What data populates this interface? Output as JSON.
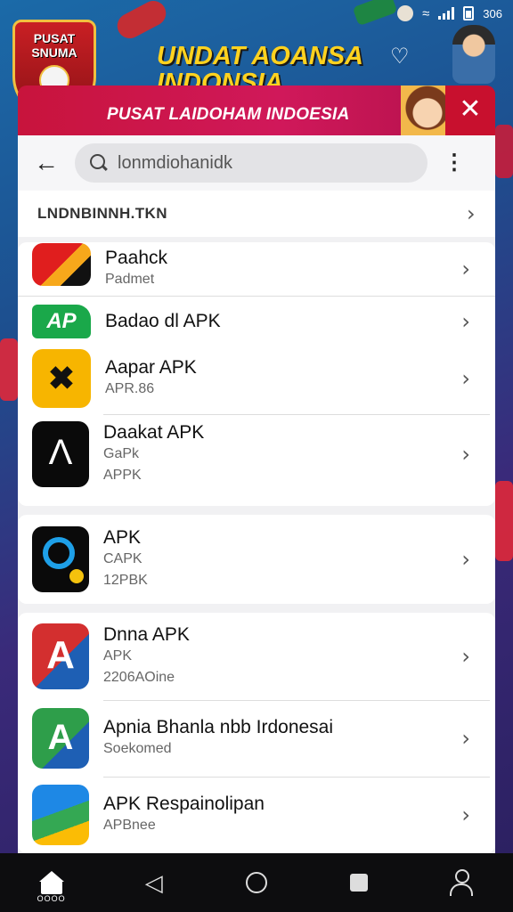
{
  "status_bar": {
    "battery": "306"
  },
  "promo": {
    "logo_text": "PUSAT SNUMA",
    "headline": "UNDAT AOANSA INDONSIA",
    "ribbon_text": "PUSAT LAIDOHAM INDOESIA"
  },
  "search": {
    "placeholder": "lonmdiohanidk"
  },
  "section_header": "LNDNBINNH.TKN",
  "apps": [
    {
      "name": "Paahck",
      "sub1": "Padmet",
      "sub2": "",
      "icon": "arrow-logo-icon",
      "color": "#e01e1e"
    },
    {
      "name": "Badao dl APK",
      "sub1": "",
      "sub2": "",
      "icon": "ap-logo-icon",
      "color": "#1aa84a"
    },
    {
      "name": "Aapar APK",
      "sub1": "APR.86",
      "sub2": "",
      "icon": "scooter-logo-icon",
      "color": "#f4b400"
    },
    {
      "name": "Daakat APK",
      "sub1": "GaPk",
      "sub2": "APPK",
      "icon": "a-logo-icon",
      "color": "#000000"
    },
    {
      "name": "APK",
      "sub1": "CAPK",
      "sub2": "12PBK",
      "icon": "magnifier-logo-icon",
      "color": "#1e88e5"
    },
    {
      "name": "Dnna APK",
      "sub1": "APK",
      "sub2": "2206AOine",
      "icon": "red-a-logo-icon",
      "color": "#d32f2f"
    },
    {
      "name": "Apnia Bhanla nbb Irdonesai",
      "sub1": "Soekomed",
      "sub2": "",
      "icon": "green-a-logo-icon",
      "color": "#2e7d32"
    },
    {
      "name": "APK Respainolipan",
      "sub1": "APBnee",
      "sub2": "",
      "icon": "maps-logo-icon",
      "color": "#1565c0"
    }
  ],
  "navbar": {
    "home_label": "OOOO"
  }
}
